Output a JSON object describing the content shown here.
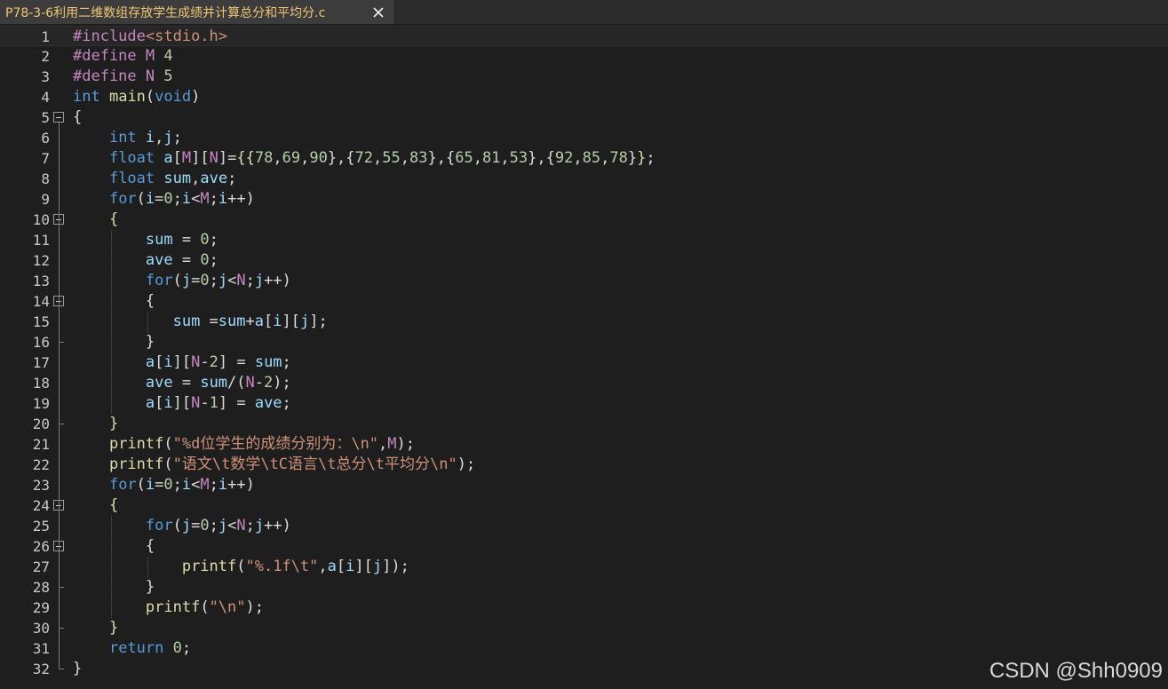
{
  "tab": {
    "title": "P78-3-6利用二维数组存放学生成绩并计算总分和平均分.c",
    "close_icon": "close-icon"
  },
  "colors": {
    "background": "#1e1e1e",
    "keyword": "#569cd6",
    "type": "#4ec9b0",
    "macro": "#c586c0",
    "number": "#b5cea8",
    "string": "#ce9178",
    "function": "#dcdcaa",
    "variable": "#9cdcfe"
  },
  "editor": {
    "lines": [
      {
        "n": "1",
        "html": "<span style='color:#c586c0'>#include</span><span style='color:#ce9178'>&lt;stdio.h&gt;</span>"
      },
      {
        "n": "2",
        "html": "<span style='color:#c586c0'>#define</span> <span style='color:#c586c0'>M</span> <span style='color:#b5cea8'>4</span>"
      },
      {
        "n": "3",
        "html": "<span style='color:#c586c0'>#define</span> <span style='color:#c586c0'>N</span> <span style='color:#b5cea8'>5</span>"
      },
      {
        "n": "4",
        "html": "<span style='color:#569cd6'>int</span> <span style='color:#dcdcaa'>main</span>(<span style='color:#569cd6'>void</span>)"
      },
      {
        "n": "5",
        "html": "{"
      },
      {
        "n": "6",
        "html": "    <span style='color:#569cd6'>int</span> <span style='color:#9cdcfe'>i</span>,<span style='color:#9cdcfe'>j</span>;"
      },
      {
        "n": "7",
        "html": "    <span style='color:#569cd6'>float</span> <span style='color:#9cdcfe'>a</span>[<span style='color:#c586c0'>M</span>][<span style='color:#c586c0'>N</span>]=<span style='color:#dcdcaa'>{</span><span style='color:#dcdcaa'>{</span><span style='color:#b5cea8'>78</span>,<span style='color:#b5cea8'>69</span>,<span style='color:#b5cea8'>90</span>},{<span style='color:#b5cea8'>72</span>,<span style='color:#b5cea8'>55</span>,<span style='color:#b5cea8'>83</span>},{<span style='color:#b5cea8'>65</span>,<span style='color:#b5cea8'>81</span>,<span style='color:#b5cea8'>53</span>},{<span style='color:#b5cea8'>92</span>,<span style='color:#b5cea8'>85</span>,<span style='color:#b5cea8'>78</span>}<span style='color:#dcdcaa'>}</span>;"
      },
      {
        "n": "8",
        "html": "    <span style='color:#569cd6'>float</span> <span style='color:#9cdcfe'>sum</span>,<span style='color:#9cdcfe'>ave</span>;"
      },
      {
        "n": "9",
        "html": "    <span style='color:#569cd6'>for</span>(<span style='color:#9cdcfe'>i</span>=<span style='color:#b5cea8'>0</span>;<span style='color:#9cdcfe'>i</span>&lt;<span style='color:#c586c0'>M</span>;<span style='color:#9cdcfe'>i</span>++)"
      },
      {
        "n": "10",
        "html": "    <span style='color:#dcdcaa'>{</span>"
      },
      {
        "n": "11",
        "html": "        <span style='color:#9cdcfe'>sum</span> = <span style='color:#b5cea8'>0</span>;"
      },
      {
        "n": "12",
        "html": "        <span style='color:#9cdcfe'>ave</span> = <span style='color:#b5cea8'>0</span>;"
      },
      {
        "n": "13",
        "html": "        <span style='color:#569cd6'>for</span>(<span style='color:#9cdcfe'>j</span>=<span style='color:#b5cea8'>0</span>;<span style='color:#9cdcfe'>j</span>&lt;<span style='color:#c586c0'>N</span>;<span style='color:#9cdcfe'>j</span>++)"
      },
      {
        "n": "14",
        "html": "        {"
      },
      {
        "n": "15",
        "html": "           <span style='color:#9cdcfe'>sum</span> =<span style='color:#9cdcfe'>sum</span>+<span style='color:#9cdcfe'>a</span>[<span style='color:#9cdcfe'>i</span>][<span style='color:#9cdcfe'>j</span>];"
      },
      {
        "n": "16",
        "html": "        }"
      },
      {
        "n": "17",
        "html": "        <span style='color:#9cdcfe'>a</span>[<span style='color:#9cdcfe'>i</span>][<span style='color:#c586c0'>N</span>-<span style='color:#b5cea8'>2</span>] = <span style='color:#9cdcfe'>sum</span>;"
      },
      {
        "n": "18",
        "html": "        <span style='color:#9cdcfe'>ave</span> = <span style='color:#9cdcfe'>sum</span>/(<span style='color:#c586c0'>N</span>-<span style='color:#b5cea8'>2</span>);"
      },
      {
        "n": "19",
        "html": "        <span style='color:#9cdcfe'>a</span>[<span style='color:#9cdcfe'>i</span>][<span style='color:#c586c0'>N</span>-<span style='color:#b5cea8'>1</span>] = <span style='color:#9cdcfe'>ave</span>;"
      },
      {
        "n": "20",
        "html": "    <span style='color:#dcdcaa'>}</span>"
      },
      {
        "n": "21",
        "html": "    <span style='color:#dcdcaa'>printf</span>(<span style='color:#ce9178'>\"%d位学生的成绩分别为：\\n\"</span>,<span style='color:#c586c0'>M</span>);"
      },
      {
        "n": "22",
        "html": "    <span style='color:#dcdcaa'>printf</span>(<span style='color:#ce9178'>\"语文\\t数学\\tC语言\\t总分\\t平均分\\n\"</span>);"
      },
      {
        "n": "23",
        "html": "    <span style='color:#569cd6'>for</span>(<span style='color:#9cdcfe'>i</span>=<span style='color:#b5cea8'>0</span>;<span style='color:#9cdcfe'>i</span>&lt;<span style='color:#c586c0'>M</span>;<span style='color:#9cdcfe'>i</span>++)"
      },
      {
        "n": "24",
        "html": "    <span style='color:#dcdcaa'>{</span>"
      },
      {
        "n": "25",
        "html": "        <span style='color:#569cd6'>for</span>(<span style='color:#9cdcfe'>j</span>=<span style='color:#b5cea8'>0</span>;<span style='color:#9cdcfe'>j</span>&lt;<span style='color:#c586c0'>N</span>;<span style='color:#9cdcfe'>j</span>++)"
      },
      {
        "n": "26",
        "html": "        {"
      },
      {
        "n": "27",
        "html": "            <span style='color:#dcdcaa'>printf</span>(<span style='color:#ce9178'>\"%.1f\\t\"</span>,<span style='color:#9cdcfe'>a</span>[<span style='color:#9cdcfe'>i</span>][<span style='color:#9cdcfe'>j</span>]);"
      },
      {
        "n": "28",
        "html": "        }"
      },
      {
        "n": "29",
        "html": "        <span style='color:#dcdcaa'>printf</span>(<span style='color:#ce9178'>\"\\n\"</span>);"
      },
      {
        "n": "30",
        "html": "    <span style='color:#dcdcaa'>}</span>"
      },
      {
        "n": "31",
        "html": "    <span style='color:#569cd6'>return</span> <span style='color:#b5cea8'>0</span>;"
      },
      {
        "n": "32",
        "html": "}"
      }
    ],
    "fold_markers": [
      "5",
      "10",
      "14",
      "24",
      "26"
    ]
  },
  "watermark": "CSDN @Shh0909"
}
